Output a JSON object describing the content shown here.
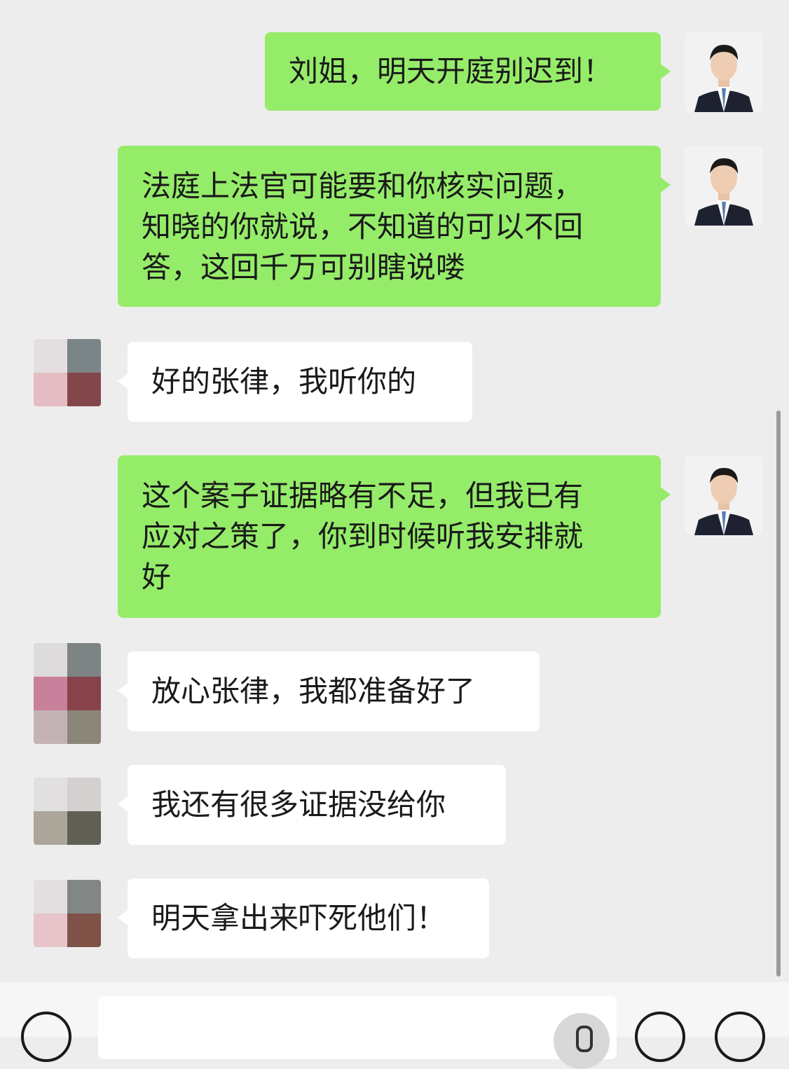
{
  "messages": [
    {
      "side": "sent",
      "text_lines": [
        "刘姐，明天开庭别迟到！"
      ]
    },
    {
      "side": "sent",
      "text_lines": [
        "法庭上法官可能要和你核实问题，",
        "知晓的你就说，不知道的可以不回",
        "答，这回千万可别瞎说喽"
      ]
    },
    {
      "side": "recv",
      "text_lines": [
        "好的张律，我听你的"
      ]
    },
    {
      "side": "sent",
      "text_lines": [
        "这个案子证据略有不足，但我已有",
        "应对之策了，你到时候听我安排就",
        "好"
      ]
    },
    {
      "side": "recv",
      "text_lines": [
        "放心张律，我都准备好了"
      ]
    },
    {
      "side": "recv",
      "text_lines": [
        "我还有很多证据没给你"
      ]
    },
    {
      "side": "recv",
      "text_lines": [
        "明天拿出来吓死他们！"
      ]
    }
  ],
  "colors": {
    "background": "#ededed",
    "sent_bubble": "#95ec69",
    "recv_bubble": "#ffffff"
  },
  "toolbar": {
    "icons": [
      "voice-icon",
      "microphone-icon",
      "emoji-icon",
      "plus-icon"
    ]
  }
}
